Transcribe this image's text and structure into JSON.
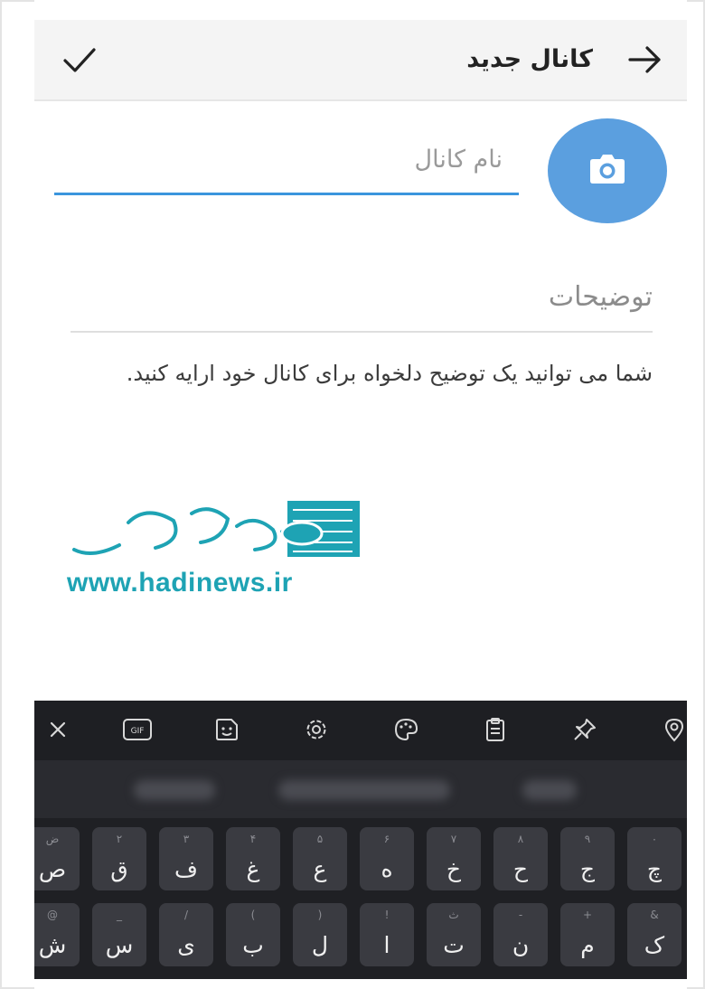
{
  "header": {
    "title": "کانال جدید"
  },
  "channel_name": {
    "value": "",
    "placeholder": "نام کانال"
  },
  "description": {
    "value": "",
    "placeholder": "توضیحات",
    "hint": "شما می توانید یک توضیح دلخواه برای کانال خود ارایه کنید."
  },
  "watermark": {
    "url": "www.hadinews.ir",
    "logo_text": "هادی"
  },
  "keyboard": {
    "toolbar_icons": [
      "close-icon",
      "gif-icon",
      "sticker-icon",
      "gear-icon",
      "palette-icon",
      "clipboard-icon",
      "pin-icon",
      "location-icon"
    ],
    "row1": [
      {
        "main": "چ",
        "sub": "۰"
      },
      {
        "main": "ج",
        "sub": "۹"
      },
      {
        "main": "ح",
        "sub": "۸"
      },
      {
        "main": "خ",
        "sub": "۷"
      },
      {
        "main": "ه",
        "sub": "۶"
      },
      {
        "main": "ع",
        "sub": "۵"
      },
      {
        "main": "غ",
        "sub": "۴"
      },
      {
        "main": "ف",
        "sub": "۳"
      },
      {
        "main": "ق",
        "sub": "۲"
      },
      {
        "main": "ص",
        "sub": "ض"
      }
    ],
    "row2": [
      {
        "main": "ک",
        "sub": "&"
      },
      {
        "main": "م",
        "sub": "+"
      },
      {
        "main": "ن",
        "sub": "-"
      },
      {
        "main": "ت",
        "sub": "ث"
      },
      {
        "main": "ا",
        "sub": "!"
      },
      {
        "main": "ل",
        "sub": ")"
      },
      {
        "main": "ب",
        "sub": "("
      },
      {
        "main": "ی",
        "sub": "/"
      },
      {
        "main": "س",
        "sub": "_"
      },
      {
        "main": "ش",
        "sub": "@"
      }
    ]
  },
  "colors": {
    "accent": "#5b9fdf",
    "input_underline": "#3b95dd",
    "keyboard_bg": "#1f2024",
    "key_bg": "#3a3b41",
    "watermark": "#1ea3b4"
  }
}
